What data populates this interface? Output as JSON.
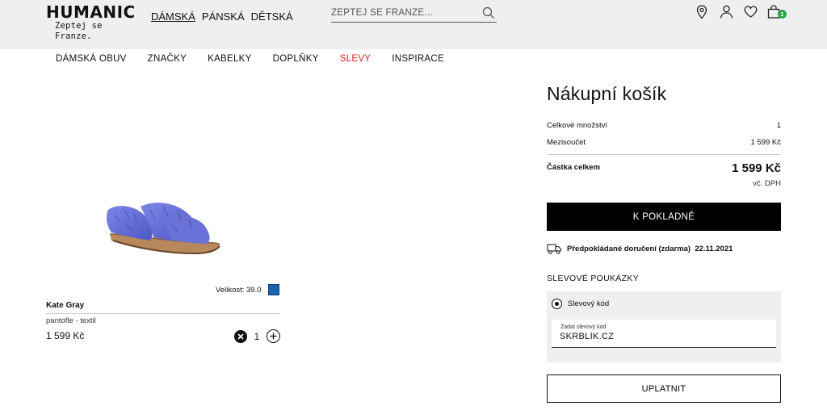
{
  "header": {
    "logo": "HUMANIC",
    "tagline": "Zeptej se Franze.",
    "categories": [
      {
        "label": "DÁMSKÁ",
        "active": true
      },
      {
        "label": "PÁNSKÁ",
        "active": false
      },
      {
        "label": "DĚTSKÁ",
        "active": false
      }
    ],
    "search_placeholder": "ZEPTEJ SE FRANZE...",
    "icons": [
      "location-icon",
      "user-icon",
      "heart-icon",
      "cart-icon"
    ],
    "cart_count": "1",
    "cart_badge_color": "#2aa84a"
  },
  "nav": {
    "items": [
      "DÁMSKÁ OBUV",
      "ZNAČKY",
      "KABELKY",
      "DOPLŇKY",
      "SLEVY",
      "INSPIRACE"
    ],
    "sale_color": "#e32222"
  },
  "product": {
    "size_label": "Velikost: 39.0",
    "color_swatch": "#1d63b0",
    "brand": "Kate Gray",
    "description": "pantofle - textil",
    "price": "1 599 Kč",
    "quantity": "1"
  },
  "cart": {
    "title": "Nákupní košík",
    "quantity_label": "Celkové množství",
    "quantity_value": "1",
    "subtotal_label": "Mezisoučet",
    "subtotal_value": "1 599 Kč",
    "total_label": "Částka celkem",
    "total_value": "1 599 Kč",
    "vat_note": "vč. DPH",
    "checkout_label": "K POKLADNĚ",
    "delivery_text": "Předpokládané doručení (zdarma)  22.11.2021"
  },
  "voucher": {
    "heading": "SLEVOVÉ POUKÁZKY",
    "option_label": "Slevový kód",
    "field_label": "Zadat slevový kód",
    "field_value": "SKRBLÍK.CZ",
    "apply_label": "UPLATNIT"
  }
}
